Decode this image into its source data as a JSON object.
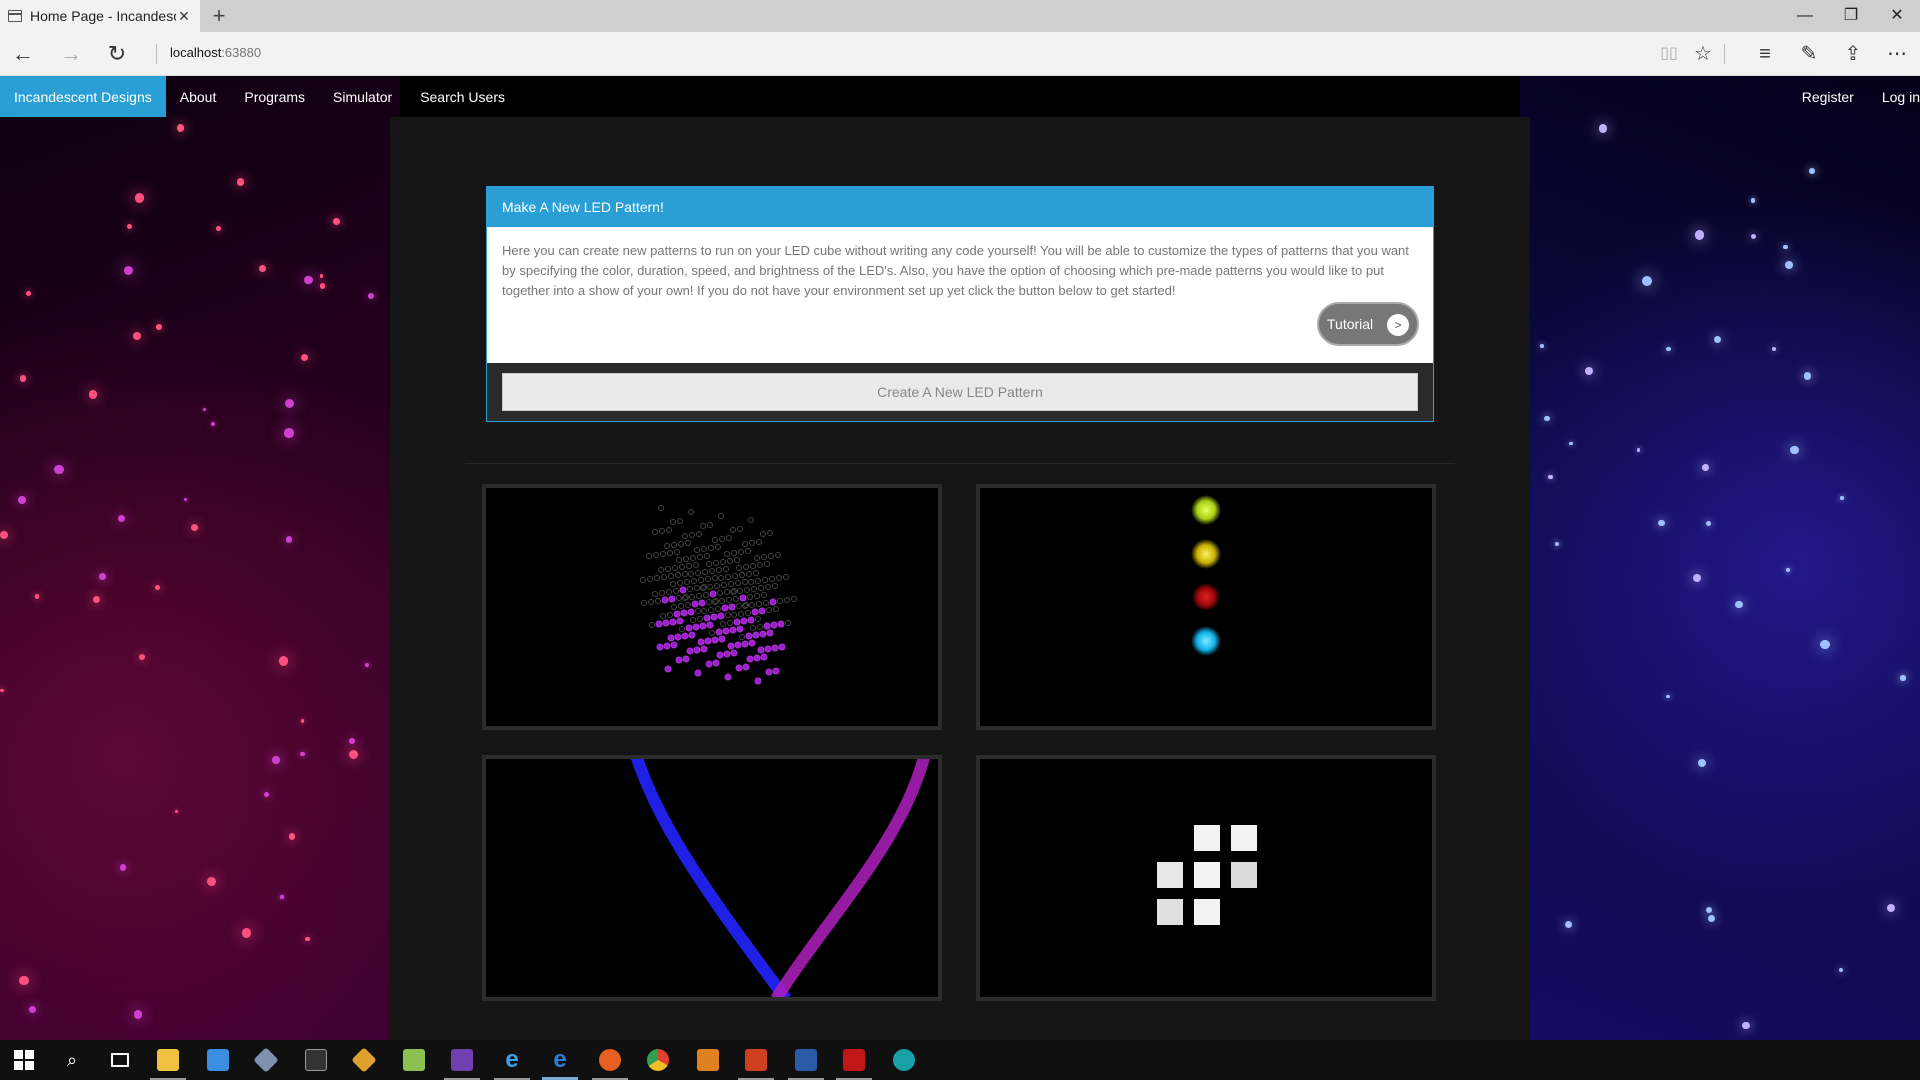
{
  "browser": {
    "tab_title": "Home Page - Incandeso",
    "new_tab_icon": "+",
    "url_host": "localhost",
    "url_port": ":63880",
    "window_controls": [
      "minimize",
      "restore",
      "close"
    ]
  },
  "nav": {
    "brand": "Incandescent Designs",
    "links": [
      "About",
      "Programs",
      "Simulator",
      "Search Users"
    ],
    "right": [
      "Register",
      "Log in"
    ]
  },
  "panel": {
    "heading": "Make A New LED Pattern!",
    "body": "Here you can create new patterns to run on your LED cube without writing any code yourself! You will be able to customize the types of patterns that you want by specifying the color, duration, speed, and brightness of the LED's. Also, you have the option of choosing which pre-made patterns you would like to put together into a show of your own! If you do not have your environment set up yet click the button below to get started!",
    "tutorial_label": "Tutorial",
    "tutorial_icon": ">",
    "create_label": "Create A New LED Pattern"
  },
  "tiles": [
    {
      "name": "led-cube-preview",
      "desc_icon": "cube-grid"
    },
    {
      "name": "traffic-lights-preview",
      "colors": [
        "#c8f020",
        "#e0d010",
        "#c01010",
        "#20c8f0"
      ]
    },
    {
      "name": "light-trails-preview",
      "colors": [
        "#2222ff",
        "#b020c0"
      ]
    },
    {
      "name": "block-grid-preview",
      "color": "#eeeeee"
    }
  ],
  "taskbar": {
    "icons": [
      "start-icon",
      "search-icon",
      "task-view-icon",
      "file-explorer-icon",
      "store-icon",
      "virtualbox-icon",
      "terminal-icon",
      "git-icon",
      "notepad-icon",
      "visual-studio-icon",
      "internet-explorer-icon",
      "edge-icon",
      "firefox-icon",
      "chrome-icon",
      "java-icon",
      "powerpoint-icon",
      "word-icon",
      "acrobat-icon",
      "arduino-icon"
    ]
  }
}
